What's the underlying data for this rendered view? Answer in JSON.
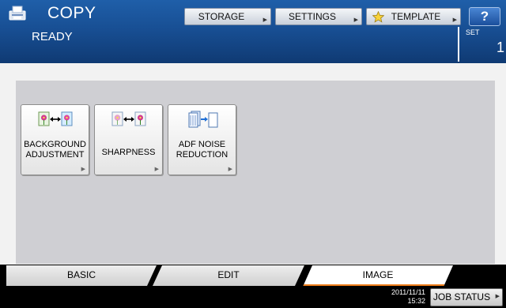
{
  "header": {
    "app_title": "COPY",
    "status": "READY",
    "buttons": {
      "storage": "STORAGE",
      "settings": "SETTINGS",
      "template": "TEMPLATE",
      "help": "?"
    },
    "set_label": "SET",
    "set_count": "1"
  },
  "functions": [
    {
      "label": "BACKGROUND\nADJUSTMENT",
      "icon": "background-adjust-icon"
    },
    {
      "label": "SHARPNESS",
      "icon": "sharpness-icon"
    },
    {
      "label": "ADF NOISE\nREDUCTION",
      "icon": "adf-noise-icon"
    }
  ],
  "tabs": {
    "basic": "BASIC",
    "edit": "EDIT",
    "image": "IMAGE",
    "active": "IMAGE"
  },
  "footer": {
    "date": "2011/11/11",
    "time": "15:32",
    "job_status": "JOB STATUS"
  },
  "colors": {
    "header_blue": "#184f94",
    "active_tab_accent": "#ee7d1a",
    "panel_gray": "#cfcfd3"
  }
}
